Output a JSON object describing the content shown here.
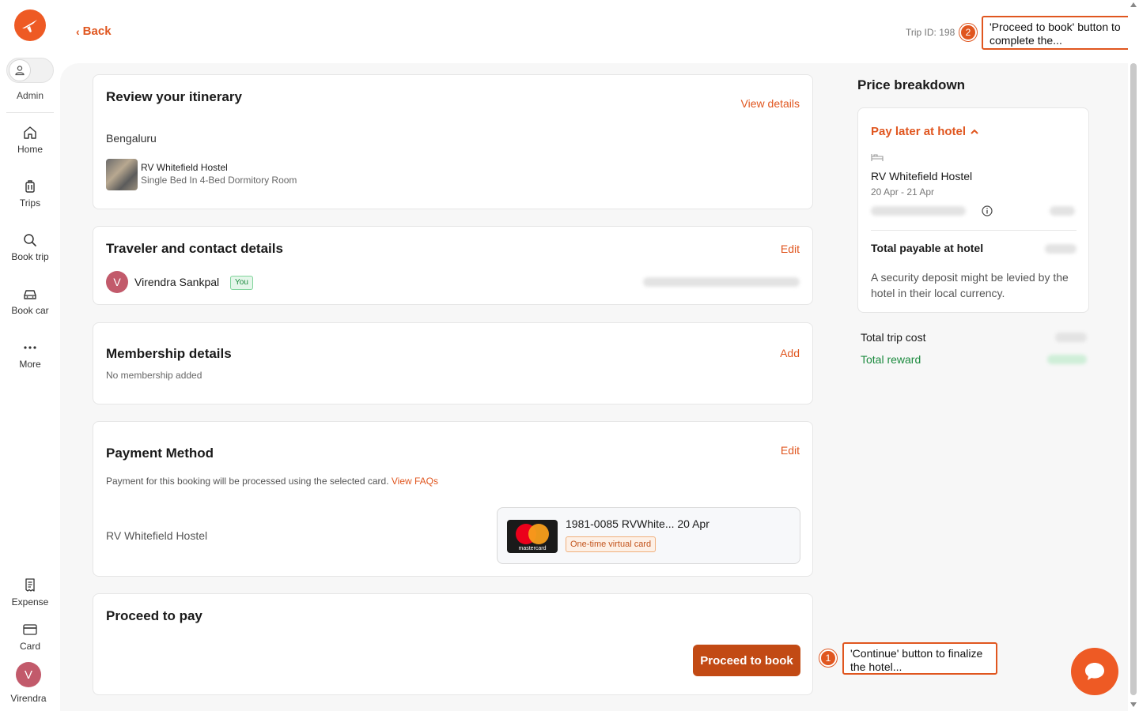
{
  "sidebar": {
    "admin_label": "Admin",
    "items": [
      {
        "label": "Home",
        "icon": "home-icon"
      },
      {
        "label": "Trips",
        "icon": "luggage-icon"
      },
      {
        "label": "Book trip",
        "icon": "search-icon"
      },
      {
        "label": "Book car",
        "icon": "car-icon"
      },
      {
        "label": "More",
        "icon": "more-icon"
      }
    ],
    "bottom_items": [
      {
        "label": "Expense",
        "icon": "receipt-icon"
      },
      {
        "label": "Card",
        "icon": "credit-card-icon"
      }
    ],
    "user": {
      "initial": "V",
      "name": "Virendra"
    }
  },
  "header": {
    "back_label": "Back",
    "trip_id": "Trip ID: 198"
  },
  "itinerary": {
    "title": "Review your itinerary",
    "view_details": "View details",
    "city": "Bengaluru",
    "hotel_name": "RV Whitefield Hostel",
    "room": "Single Bed In 4-Bed Dormitory Room"
  },
  "traveler": {
    "title": "Traveler and contact details",
    "edit": "Edit",
    "initial": "V",
    "name": "Virendra Sankpal",
    "badge": "You"
  },
  "membership": {
    "title": "Membership details",
    "add": "Add",
    "empty": "No membership added"
  },
  "payment": {
    "title": "Payment Method",
    "edit": "Edit",
    "note": "Payment for this booking will be processed using the selected card.",
    "faq_link": "View FAQs",
    "hotel": "RV Whitefield Hostel",
    "card_title": "1981-0085 RVWhite... 20 Apr",
    "card_badge": "One-time virtual card",
    "card_brand": "mastercard"
  },
  "proceed": {
    "title": "Proceed to pay",
    "button": "Proceed to book"
  },
  "price": {
    "title": "Price breakdown",
    "pay_later": "Pay later at hotel",
    "hotel": "RV Whitefield Hostel",
    "dates": "20 Apr - 21 Apr",
    "total_hotel_label": "Total payable at hotel",
    "deposit_note": "A security deposit might be levied by the hotel in their local currency.",
    "total_trip_label": "Total trip cost",
    "total_reward_label": "Total reward"
  },
  "annotations": [
    {
      "number": "1",
      "text": "'Continue' button to finalize the hotel..."
    },
    {
      "number": "2",
      "text": "'Proceed to book' button to complete the..."
    }
  ],
  "colors": {
    "accent": "#e0561f",
    "button": "#c24a14",
    "reward": "#1b8a3e"
  }
}
